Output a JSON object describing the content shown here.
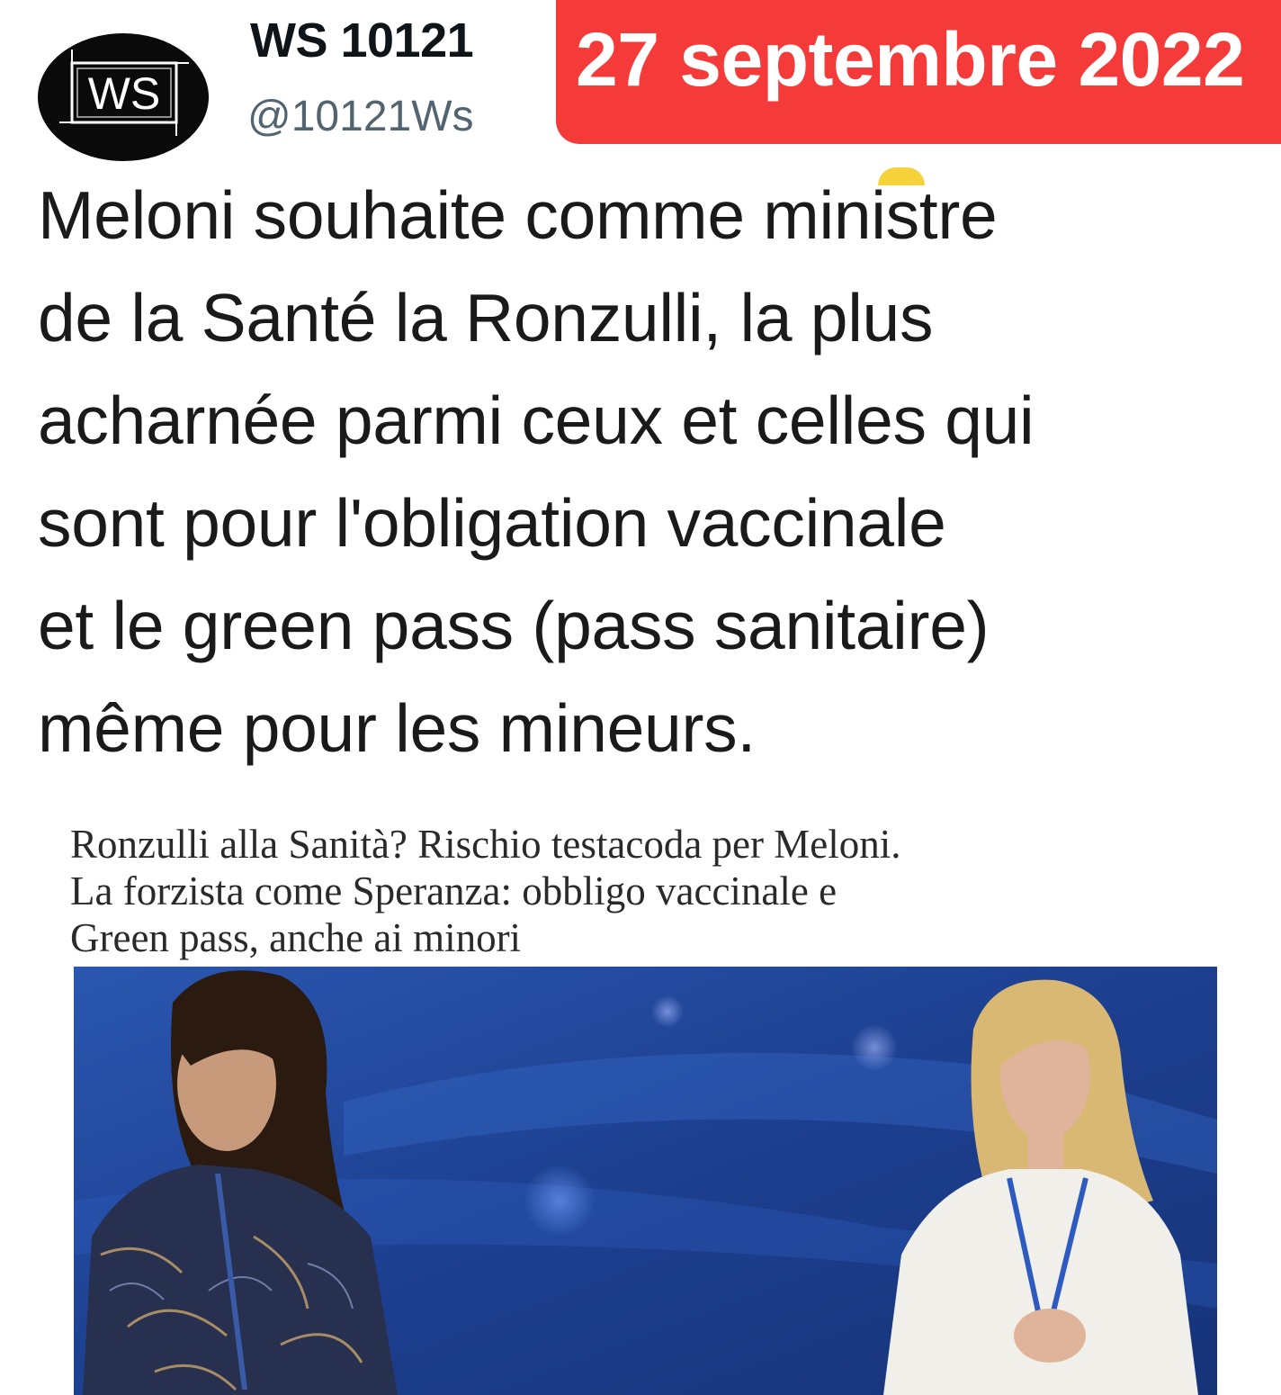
{
  "author": {
    "display_name": "WS 10121",
    "handle": "@10121Ws",
    "avatar_text": "WS",
    "avatar_icon": "ws-logo-avatar"
  },
  "date_badge": {
    "text": "27 septembre 2022",
    "color": "#f53a3a"
  },
  "tweet": {
    "lines": [
      "Meloni souhaite comme ministre",
      "de la Santé la Ronzulli, la plus",
      "acharnée parmi ceux et celles qui",
      "sont pour l'obligation vaccinale",
      "et le green pass (pass sanitaire)",
      "même pour les mineurs."
    ]
  },
  "article": {
    "headline_lines": [
      "Ronzulli alla Sanità? Rischio testacoda per Meloni.",
      "La forzista come Speranza: obbligo vaccinale e",
      "Green pass, anche ai minori"
    ],
    "image_icon": "two-women-conference-photo"
  },
  "colors": {
    "text": "#1a1a1a",
    "handle": "#536471",
    "badge": "#f53a3a",
    "photo_bg": "#1d3f8f"
  }
}
